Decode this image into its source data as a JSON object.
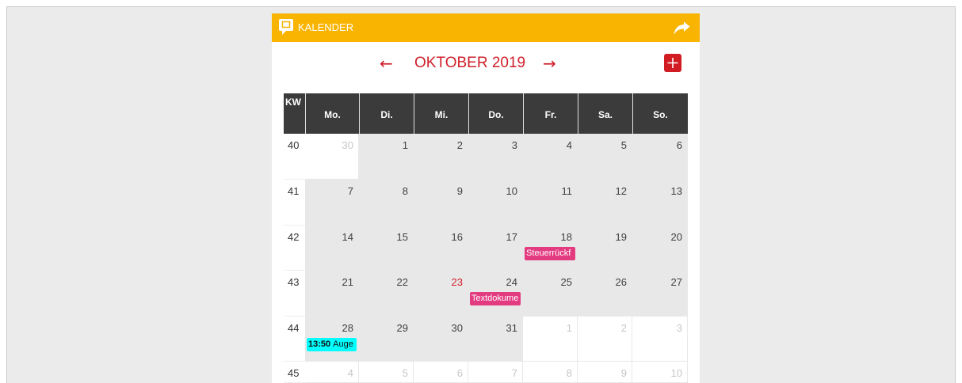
{
  "page": {
    "background": "#ebebeb"
  },
  "widget": {
    "title": "KALENDER",
    "colors": {
      "header_bar": "#f8b400",
      "accent_red": "#cf1f2a",
      "table_header": "#3b3b3b",
      "in_month_cell": "#e8e8e8",
      "other_month_cell": "#ffffff",
      "event_pink": "#e33b80",
      "event_cyan": "#00ffff"
    },
    "icons": {
      "header": "calendar-icon",
      "share": "share-icon",
      "add": "plus-icon"
    },
    "nav": {
      "prev": "←",
      "month": "OKTOBER 2019",
      "next": "→"
    },
    "table": {
      "week_header": "KW",
      "day_headers": [
        "Mo.",
        "Di.",
        "Mi.",
        "Do.",
        "Fr.",
        "Sa.",
        "So."
      ],
      "weeks": [
        {
          "kw": "40",
          "days": [
            {
              "number": "30",
              "in_month": false
            },
            {
              "number": "1",
              "in_month": true
            },
            {
              "number": "2",
              "in_month": true
            },
            {
              "number": "3",
              "in_month": true
            },
            {
              "number": "4",
              "in_month": true
            },
            {
              "number": "5",
              "in_month": true
            },
            {
              "number": "6",
              "in_month": true
            }
          ]
        },
        {
          "kw": "41",
          "days": [
            {
              "number": "7",
              "in_month": true
            },
            {
              "number": "8",
              "in_month": true
            },
            {
              "number": "9",
              "in_month": true
            },
            {
              "number": "10",
              "in_month": true
            },
            {
              "number": "11",
              "in_month": true
            },
            {
              "number": "12",
              "in_month": true
            },
            {
              "number": "13",
              "in_month": true
            }
          ]
        },
        {
          "kw": "42",
          "days": [
            {
              "number": "14",
              "in_month": true
            },
            {
              "number": "15",
              "in_month": true
            },
            {
              "number": "16",
              "in_month": true
            },
            {
              "number": "17",
              "in_month": true
            },
            {
              "number": "18",
              "in_month": true,
              "events": [
                {
                  "title": "Steuerrückf",
                  "color": "#e33b80"
                }
              ]
            },
            {
              "number": "19",
              "in_month": true
            },
            {
              "number": "20",
              "in_month": true
            }
          ]
        },
        {
          "kw": "43",
          "days": [
            {
              "number": "21",
              "in_month": true
            },
            {
              "number": "22",
              "in_month": true
            },
            {
              "number": "23",
              "in_month": true,
              "today": true
            },
            {
              "number": "24",
              "in_month": true,
              "events": [
                {
                  "title": "Textdokume",
                  "color": "#e33b80"
                }
              ]
            },
            {
              "number": "25",
              "in_month": true
            },
            {
              "number": "26",
              "in_month": true
            },
            {
              "number": "27",
              "in_month": true
            }
          ]
        },
        {
          "kw": "44",
          "days": [
            {
              "number": "28",
              "in_month": true,
              "events": [
                {
                  "time": "13:50",
                  "title": "Auge",
                  "color": "#00ffff"
                }
              ]
            },
            {
              "number": "29",
              "in_month": true
            },
            {
              "number": "30",
              "in_month": true
            },
            {
              "number": "31",
              "in_month": true
            },
            {
              "number": "1",
              "in_month": false
            },
            {
              "number": "2",
              "in_month": false
            },
            {
              "number": "3",
              "in_month": false
            }
          ]
        },
        {
          "kw": "45",
          "days": [
            {
              "number": "4",
              "in_month": false
            },
            {
              "number": "5",
              "in_month": false
            },
            {
              "number": "6",
              "in_month": false
            },
            {
              "number": "7",
              "in_month": false
            },
            {
              "number": "8",
              "in_month": false
            },
            {
              "number": "9",
              "in_month": false
            },
            {
              "number": "10",
              "in_month": false
            }
          ]
        }
      ]
    }
  }
}
